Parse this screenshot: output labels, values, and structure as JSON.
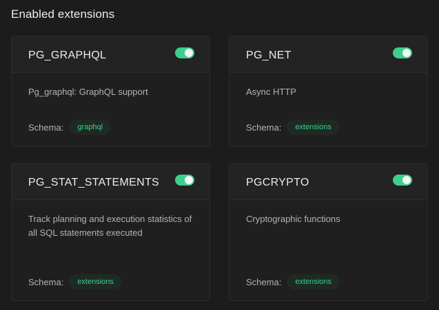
{
  "section": {
    "title": "Enabled extensions"
  },
  "extensions": [
    {
      "name": "PG_GRAPHQL",
      "description": "Pg_graphql: GraphQL support",
      "schema_label": "Schema:",
      "schema": "graphql",
      "enabled": true
    },
    {
      "name": "PG_NET",
      "description": "Async HTTP",
      "schema_label": "Schema:",
      "schema": "extensions",
      "enabled": true
    },
    {
      "name": "PG_STAT_STATEMENTS",
      "description": "Track planning and execution statistics of all SQL statements executed",
      "schema_label": "Schema:",
      "schema": "extensions",
      "enabled": true
    },
    {
      "name": "PGCRYPTO",
      "description": "Cryptographic functions",
      "schema_label": "Schema:",
      "schema": "extensions",
      "enabled": true
    }
  ],
  "colors": {
    "background": "#1c1c1c",
    "card": "#1f1f1f",
    "accent": "#3ecf8e",
    "text": "#ededed",
    "muted": "#b4b4b4"
  }
}
